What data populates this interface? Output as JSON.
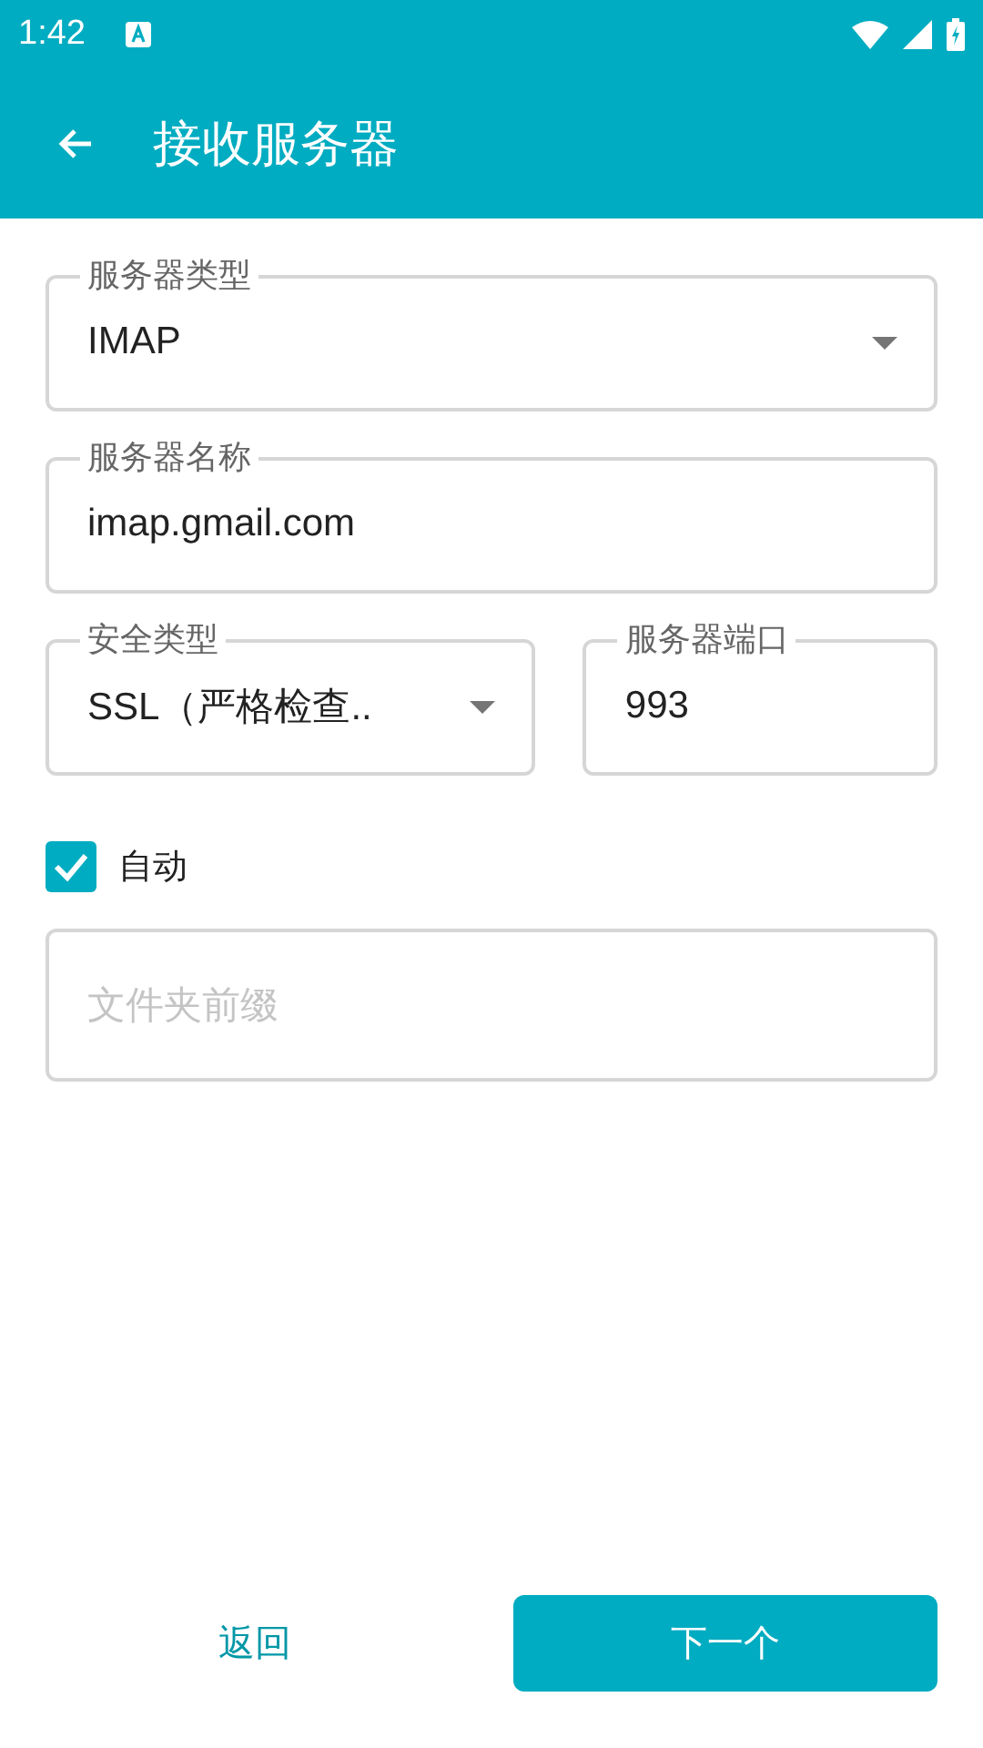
{
  "status_bar": {
    "time": "1:42"
  },
  "app_bar": {
    "title": "接收服务器"
  },
  "field_rows": [
    [
      {
        "kind": "dropdown",
        "label": "服务器类型",
        "value": "IMAP"
      }
    ],
    [
      {
        "kind": "text",
        "label": "服务器名称",
        "value": "imap.gmail.com"
      }
    ],
    [
      {
        "kind": "dropdown",
        "label": "安全类型",
        "value": "SSL（严格检查.."
      },
      {
        "kind": "text",
        "label": "服务器端口",
        "value": "993"
      }
    ]
  ],
  "checkbox": {
    "label": "自动",
    "checked": true
  },
  "prefix_field": {
    "placeholder": "文件夹前缀"
  },
  "buttons": {
    "back": "返回",
    "next": "下一个"
  }
}
